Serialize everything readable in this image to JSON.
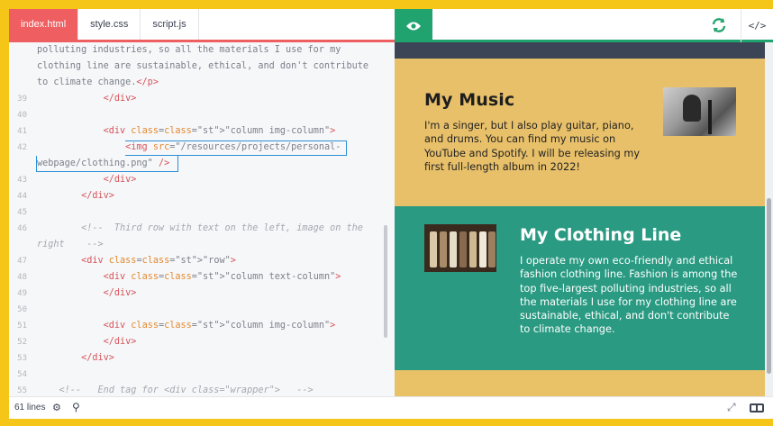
{
  "editor": {
    "tabs": [
      {
        "label": "index.html",
        "active": true
      },
      {
        "label": "style.css",
        "active": false
      },
      {
        "label": "script.js",
        "active": false
      }
    ],
    "lines": [
      {
        "num": "",
        "text": "polluting industries, so all the materials I use for my"
      },
      {
        "num": "",
        "text": "clothing line are sustainable, ethical, and don't contribute"
      },
      {
        "num": "",
        "text": "to climate change.</p>"
      },
      {
        "num": "39",
        "text": "            </div>"
      },
      {
        "num": "40",
        "text": ""
      },
      {
        "num": "41",
        "text": "            <div class=\"column img-column\">"
      },
      {
        "num": "42",
        "text": "                <img src=\"/resources/projects/personal-"
      },
      {
        "num": "",
        "text": "webpage/clothing.png\" />"
      },
      {
        "num": "43",
        "text": "            </div>"
      },
      {
        "num": "44",
        "text": "        </div>"
      },
      {
        "num": "45",
        "text": ""
      },
      {
        "num": "46",
        "text": "        <!--  Third row with text on the left, image on the"
      },
      {
        "num": "",
        "text": "right    -->"
      },
      {
        "num": "47",
        "text": "        <div class=\"row\">"
      },
      {
        "num": "48",
        "text": "            <div class=\"column text-column\">"
      },
      {
        "num": "49",
        "text": "            </div>"
      },
      {
        "num": "50",
        "text": ""
      },
      {
        "num": "51",
        "text": "            <div class=\"column img-column\">"
      },
      {
        "num": "52",
        "text": "            </div>"
      },
      {
        "num": "53",
        "text": "        </div>"
      },
      {
        "num": "54",
        "text": ""
      },
      {
        "num": "55",
        "text": "    <!--   End tag for <div class=\"wrapper\">   -->"
      }
    ]
  },
  "preview": {
    "toolbar": {
      "code_label": "</>"
    },
    "music": {
      "title": "My Music",
      "text": "I'm a singer, but I also play guitar, piano, and drums. You can find my music on YouTube and Spotify. I will be releasing my first full-length album in 2022!"
    },
    "clothing": {
      "title": "My Clothing Line",
      "text": "I operate my own eco-friendly and ethical fashion clothing line. Fashion is among the top five-largest polluting industries, so all the materials I use for my clothing line are sustainable, ethical, and don't contribute to climate change."
    }
  },
  "footer": {
    "lines_count": "61 lines"
  },
  "colors": {
    "accent_red": "#ef5e60",
    "accent_green": "#21a370",
    "music_bg": "#e8c06a",
    "clothing_bg": "#2a9a82",
    "frame_bg": "#f5c518"
  },
  "icons": [
    "eye-icon",
    "refresh-icon",
    "code-icon",
    "bug-icon",
    "search-icon",
    "expand-icon",
    "layout-icon"
  ]
}
